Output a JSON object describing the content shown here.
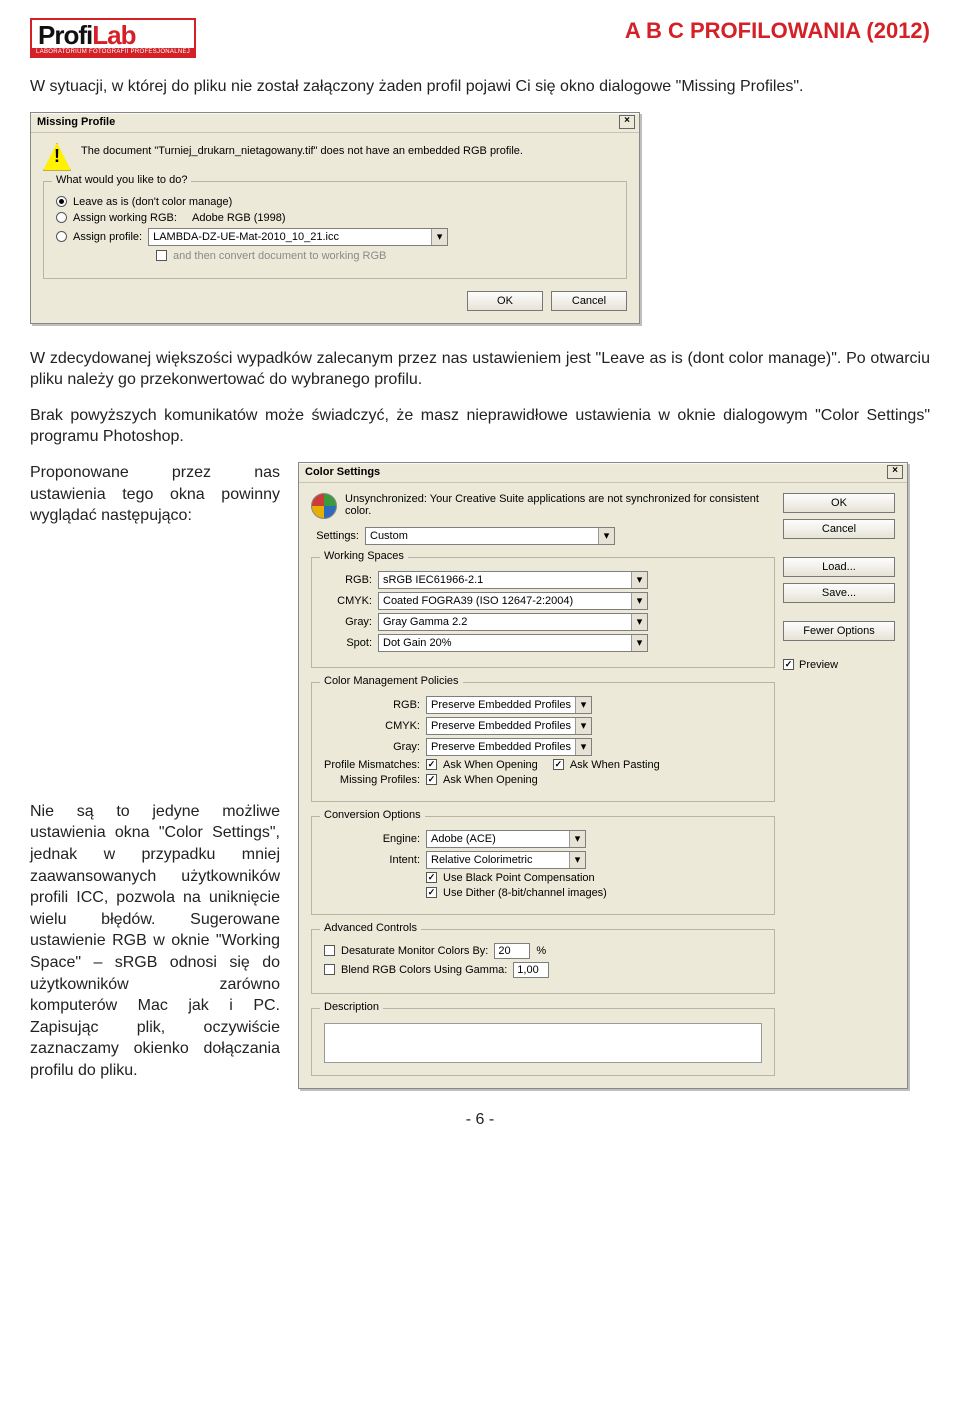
{
  "header": {
    "title": "A B C  PROFILOWANIA (2012)",
    "logo_main_1": "Profi",
    "logo_main_2": "Lab",
    "logo_sub": "LABORATORIUM FOTOGRAFII PROFESJONALNEJ"
  },
  "paragraphs": {
    "p1": "W sytuacji, w której do pliku nie został załączony żaden profil pojawi Ci się okno dialogowe \"Missing Profiles\".",
    "p2": "W zdecydowanej większości wypadków zalecanym przez nas ustawieniem jest \"Leave as is (dont color manage)\". Po otwarciu pliku należy go przekonwertować do wybranego profilu.",
    "p3": "Brak powyższych komunikatów może świadczyć, że masz nieprawidłowe ustawienia w oknie dialogowym \"Color Settings\" programu Photoshop.",
    "p4": "Proponowane przez nas ustawienia tego okna powinny wyglądać następująco:",
    "p5": "Nie są to jedyne możliwe ustawienia okna \"Color Settings\", jednak w przypadku mniej zaawansowanych użytkowników profili ICC, pozwola na uniknięcie wielu błędów. Sugerowane ustawienie RGB w oknie \"Working Space\" – sRGB odnosi się do użytkowników zarówno komputerów Mac jak i PC. Zapisując plik, oczywiście zaznaczamy okienko dołączania profilu do pliku."
  },
  "missing_profile": {
    "title": "Missing Profile",
    "message": "The document \"Turniej_drukarn_nietagowany.tif\" does not have an embedded RGB profile.",
    "group_title": "What would you like to do?",
    "opt1": "Leave as is (don't color manage)",
    "opt2_label": "Assign working RGB:",
    "opt2_value": "Adobe RGB (1998)",
    "opt3_label": "Assign profile:",
    "opt3_value": "LAMBDA-DZ-UE-Mat-2010_10_21.icc",
    "convert_label": "and then convert document to working RGB",
    "ok": "OK",
    "cancel": "Cancel"
  },
  "color_settings": {
    "title": "Color Settings",
    "info": "Unsynchronized: Your Creative Suite applications are not synchronized for consistent color.",
    "settings_label": "Settings:",
    "settings_value": "Custom",
    "buttons": {
      "ok": "OK",
      "cancel": "Cancel",
      "load": "Load...",
      "save": "Save...",
      "fewer": "Fewer Options",
      "preview": "Preview"
    },
    "working_spaces": {
      "title": "Working Spaces",
      "rgb_label": "RGB:",
      "rgb_value": "sRGB IEC61966-2.1",
      "cmyk_label": "CMYK:",
      "cmyk_value": "Coated FOGRA39 (ISO 12647-2:2004)",
      "gray_label": "Gray:",
      "gray_value": "Gray Gamma 2.2",
      "spot_label": "Spot:",
      "spot_value": "Dot Gain 20%"
    },
    "policies": {
      "title": "Color Management Policies",
      "rgb_label": "RGB:",
      "rgb_value": "Preserve Embedded Profiles",
      "cmyk_label": "CMYK:",
      "cmyk_value": "Preserve Embedded Profiles",
      "gray_label": "Gray:",
      "gray_value": "Preserve Embedded Profiles",
      "mismatch_label": "Profile Mismatches:",
      "mismatch_open": "Ask When Opening",
      "mismatch_paste": "Ask When Pasting",
      "missing_label": "Missing Profiles:",
      "missing_open": "Ask When Opening"
    },
    "conversion": {
      "title": "Conversion Options",
      "engine_label": "Engine:",
      "engine_value": "Adobe (ACE)",
      "intent_label": "Intent:",
      "intent_value": "Relative Colorimetric",
      "bpc": "Use Black Point Compensation",
      "dither": "Use Dither (8-bit/channel images)"
    },
    "advanced": {
      "title": "Advanced Controls",
      "desat_label": "Desaturate Monitor Colors By:",
      "desat_value": "20",
      "desat_suffix": "%",
      "blend_label": "Blend RGB Colors Using Gamma:",
      "blend_value": "1,00"
    },
    "description_title": "Description"
  },
  "footer": "- 6 -"
}
